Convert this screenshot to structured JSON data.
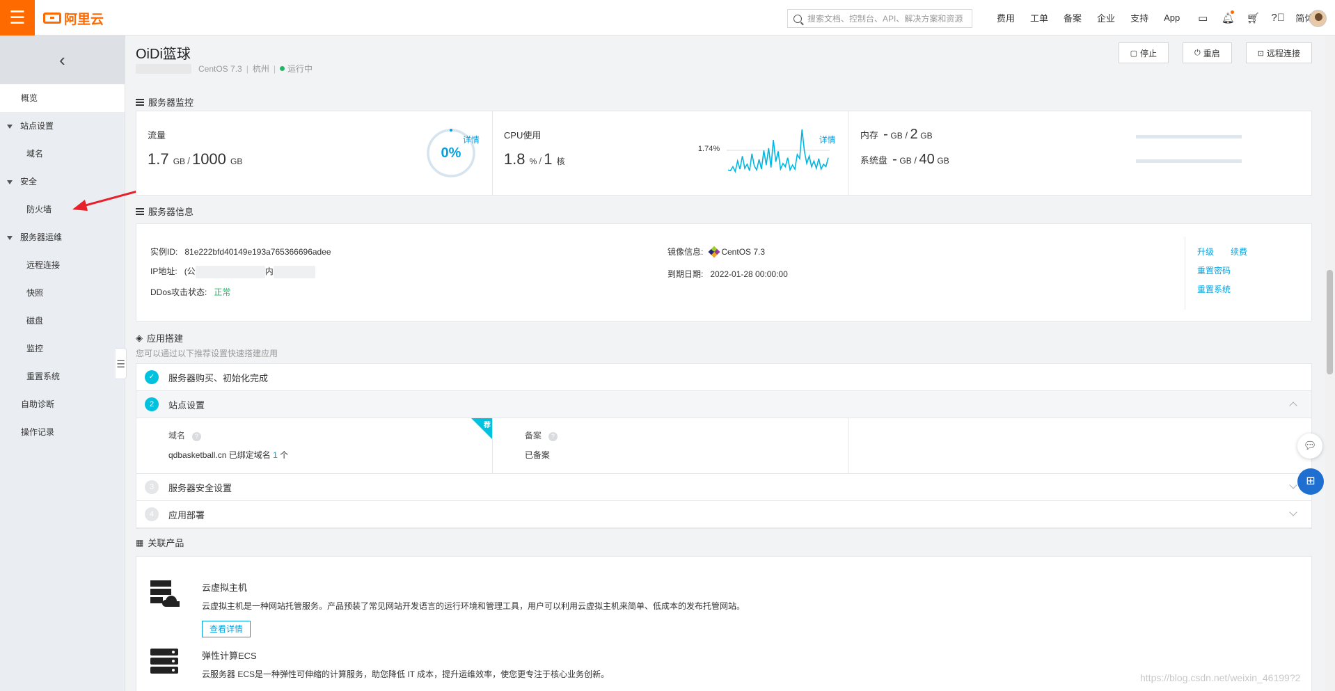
{
  "topbar": {
    "menu_icon": "hamburger-icon",
    "logo_text": "阿里云",
    "search_placeholder": "搜索文档、控制台、API、解决方案和资源",
    "nav": [
      "费用",
      "工单",
      "备案",
      "企业",
      "支持",
      "App"
    ],
    "lang": "简体",
    "icons": [
      "terminal-icon",
      "bell-icon",
      "cart-icon",
      "help-icon"
    ],
    "accent": "#ff6a00"
  },
  "sidebar": {
    "back_icon": "chevron-left-icon",
    "overview": "概览",
    "group_site": "站点设置",
    "domain": "域名",
    "group_security": "安全",
    "firewall": "防火墙",
    "group_ops": "服务器运维",
    "remote": "远程连接",
    "snapshot": "快照",
    "disk": "磁盘",
    "monitor": "监控",
    "reset_system": "重置系统",
    "self_diagnose": "自助诊断",
    "op_log": "操作记录"
  },
  "header": {
    "title": "OiDi篮球",
    "os": "CentOS 7.3",
    "region": "杭州",
    "status": "运行中",
    "buttons": {
      "stop": "停止",
      "restart": "重启",
      "remote": "远程连接"
    }
  },
  "monitor": {
    "title": "服务器监控",
    "traffic": {
      "label": "流量",
      "used": "1.7",
      "used_unit": "GB",
      "total": "1000",
      "total_unit": "GB",
      "percent_text": "0%",
      "detail": "详情"
    },
    "cpu": {
      "label": "CPU使用",
      "value": "1.8",
      "unit": "%",
      "cores": "1",
      "cores_unit": "核",
      "current": "1.74%",
      "detail": "详情"
    },
    "memory": {
      "label": "内存",
      "used": "-",
      "used_unit": "GB",
      "total": "2",
      "total_unit": "GB"
    },
    "disk": {
      "label": "系统盘",
      "used": "-",
      "used_unit": "GB",
      "total": "40",
      "total_unit": "GB"
    }
  },
  "cpu_series": [
    0.5,
    0.4,
    0.9,
    0.3,
    1.6,
    0.6,
    2.2,
    0.7,
    1.2,
    0.4,
    2.5,
    1.0,
    0.5,
    1.8,
    0.6,
    2.9,
    1.1,
    3.2,
    0.8,
    4.2,
    1.5,
    2.8,
    0.6,
    1.3,
    0.9,
    2.0,
    0.5,
    1.1,
    0.6,
    2.4,
    1.9,
    5.5,
    2.8,
    1.3,
    2.2,
    0.9,
    1.6,
    0.7,
    1.9,
    0.6,
    1.2,
    0.9,
    2.0
  ],
  "server_info": {
    "title": "服务器信息",
    "instance_label": "实例ID:",
    "instance_id": "81e222bfd40149e193a765366696adee",
    "ip_label": "IP地址:",
    "ip_public_prefix": "(公",
    "ip_private_prefix": "内",
    "ddos_label": "DDos攻击状态:",
    "ddos_value": "正常",
    "image_label": "镜像信息:",
    "image_value": "CentOS 7.3",
    "expire_label": "到期日期:",
    "expire_value": "2022-01-28 00:00:00",
    "links": {
      "upgrade": "升级",
      "renew": "续费",
      "reset_pwd": "重置密码",
      "reset_sys": "重置系统"
    }
  },
  "app_build": {
    "title": "应用搭建",
    "hint": "您可以通过以下推荐设置快速搭建应用",
    "steps": [
      {
        "num": "✓",
        "label": "服务器购买、初始化完成"
      },
      {
        "num": "2",
        "label": "站点设置"
      },
      {
        "num": "3",
        "label": "服务器安全设置"
      },
      {
        "num": "4",
        "label": "应用部署"
      }
    ],
    "domain_key": "域名",
    "domain_value": "qdbasketball.cn 已绑定域名",
    "domain_count": "1",
    "domain_count_unit": "个",
    "recommend_tag": "荐",
    "icp_key": "备案",
    "icp_value": "已备案"
  },
  "related": {
    "title": "关联产品",
    "items": [
      {
        "name": "云虚拟主机",
        "desc": "云虚拟主机是一种网站托管服务。产品预装了常见网站开发语言的运行环境和管理工具，用户可以利用云虚拟主机来简单、低成本的发布托管网站。",
        "button": "查看详情"
      },
      {
        "name": "弹性计算ECS",
        "desc": "云服务器 ECS是一种弹性可伸缩的计算服务，助您降低 IT 成本，提升运维效率，使您更专注于核心业务创新。"
      }
    ]
  },
  "watermark": "https://blog.csdn.net/weixin_46199?2"
}
